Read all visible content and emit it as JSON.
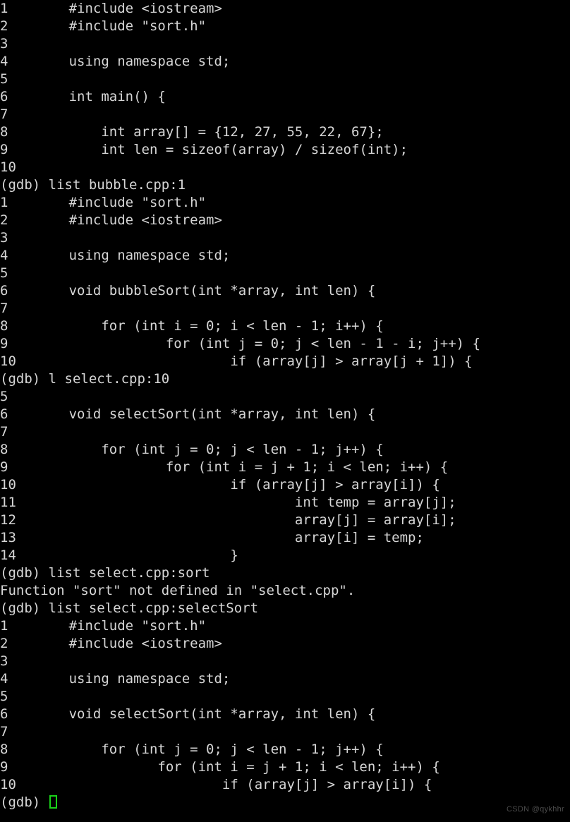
{
  "terminal": {
    "title": "gdb-session",
    "background_color": "#000000",
    "foreground_color": "#d6d6d6",
    "cursor_color": "#19d219",
    "prompt": "(gdb) ",
    "lines": [
      {
        "kind": "code",
        "lineno": "1",
        "text": "#include <iostream>"
      },
      {
        "kind": "code",
        "lineno": "2",
        "text": "#include \"sort.h\""
      },
      {
        "kind": "code",
        "lineno": "3",
        "text": ""
      },
      {
        "kind": "code",
        "lineno": "4",
        "text": "using namespace std;"
      },
      {
        "kind": "code",
        "lineno": "5",
        "text": ""
      },
      {
        "kind": "code",
        "lineno": "6",
        "text": "int main() {"
      },
      {
        "kind": "code",
        "lineno": "7",
        "text": ""
      },
      {
        "kind": "code",
        "lineno": "8",
        "text": "    int array[] = {12, 27, 55, 22, 67};"
      },
      {
        "kind": "code",
        "lineno": "9",
        "text": "    int len = sizeof(array) / sizeof(int);"
      },
      {
        "kind": "code",
        "lineno": "10",
        "text": ""
      },
      {
        "kind": "prompt",
        "command": "list bubble.cpp:1"
      },
      {
        "kind": "code",
        "lineno": "1",
        "text": "#include \"sort.h\""
      },
      {
        "kind": "code",
        "lineno": "2",
        "text": "#include <iostream>"
      },
      {
        "kind": "code",
        "lineno": "3",
        "text": ""
      },
      {
        "kind": "code",
        "lineno": "4",
        "text": "using namespace std;"
      },
      {
        "kind": "code",
        "lineno": "5",
        "text": ""
      },
      {
        "kind": "code",
        "lineno": "6",
        "text": "void bubbleSort(int *array, int len) {"
      },
      {
        "kind": "code",
        "lineno": "7",
        "text": ""
      },
      {
        "kind": "code",
        "lineno": "8",
        "text": "    for (int i = 0; i < len - 1; i++) {"
      },
      {
        "kind": "code",
        "lineno": "9",
        "text": "            for (int j = 0; j < len - 1 - i; j++) {"
      },
      {
        "kind": "code",
        "lineno": "10",
        "text": "                    if (array[j] > array[j + 1]) {"
      },
      {
        "kind": "prompt",
        "command": "l select.cpp:10"
      },
      {
        "kind": "code",
        "lineno": "5",
        "text": ""
      },
      {
        "kind": "code",
        "lineno": "6",
        "text": "void selectSort(int *array, int len) {"
      },
      {
        "kind": "code",
        "lineno": "7",
        "text": ""
      },
      {
        "kind": "code",
        "lineno": "8",
        "text": "    for (int j = 0; j < len - 1; j++) {"
      },
      {
        "kind": "code",
        "lineno": "9",
        "text": "            for (int i = j + 1; i < len; i++) {"
      },
      {
        "kind": "code",
        "lineno": "10",
        "text": "                    if (array[j] > array[i]) {"
      },
      {
        "kind": "code",
        "lineno": "11",
        "text": "                            int temp = array[j];"
      },
      {
        "kind": "code",
        "lineno": "12",
        "text": "                            array[j] = array[i];"
      },
      {
        "kind": "code",
        "lineno": "13",
        "text": "                            array[i] = temp;"
      },
      {
        "kind": "code",
        "lineno": "14",
        "text": "                    }"
      },
      {
        "kind": "prompt",
        "command": "list select.cpp:sort"
      },
      {
        "kind": "output",
        "text": "Function \"sort\" not defined in \"select.cpp\"."
      },
      {
        "kind": "prompt",
        "command": "list select.cpp:selectSort"
      },
      {
        "kind": "code",
        "lineno": "1",
        "text": "#include \"sort.h\""
      },
      {
        "kind": "code",
        "lineno": "2",
        "text": "#include <iostream>"
      },
      {
        "kind": "code",
        "lineno": "3",
        "text": ""
      },
      {
        "kind": "code",
        "lineno": "4",
        "text": "using namespace std;"
      },
      {
        "kind": "code",
        "lineno": "5",
        "text": ""
      },
      {
        "kind": "code",
        "lineno": "6",
        "text": "void selectSort(int *array, int len) {"
      },
      {
        "kind": "code",
        "lineno": "7",
        "text": ""
      },
      {
        "kind": "code",
        "lineno": "8",
        "text": "    for (int j = 0; j < len - 1; j++) {"
      },
      {
        "kind": "code",
        "lineno": "9",
        "text": "           for (int i = j + 1; i < len; i++) {"
      },
      {
        "kind": "code",
        "lineno": "10",
        "text": "                   if (array[j] > array[i]) {"
      },
      {
        "kind": "prompt",
        "command": "",
        "cursor": true
      }
    ]
  },
  "watermark": {
    "text": "CSDN @qykhhr"
  }
}
